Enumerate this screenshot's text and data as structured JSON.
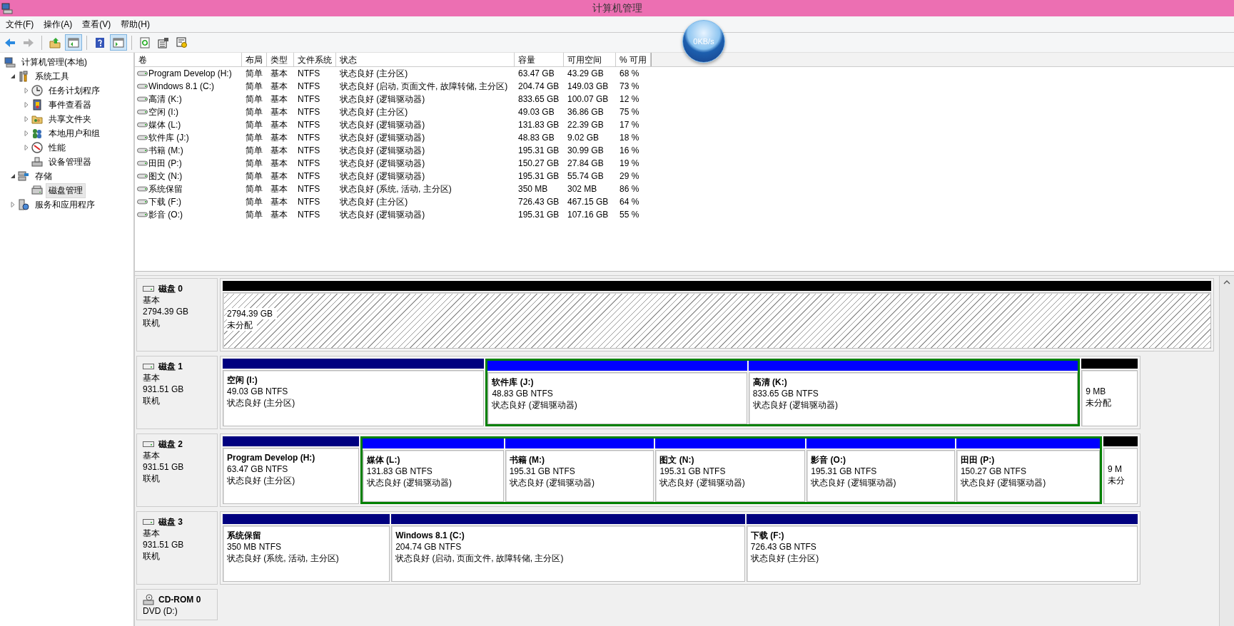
{
  "window": {
    "title": "计算机管理"
  },
  "menu": [
    "文件(F)",
    "操作(A)",
    "查看(V)",
    "帮助(H)"
  ],
  "toolbar": [
    {
      "kind": "back",
      "disabled": false,
      "pressed": false
    },
    {
      "kind": "forward",
      "disabled": true,
      "pressed": false
    },
    {
      "kind": "separator"
    },
    {
      "kind": "up",
      "disabled": false,
      "pressed": false
    },
    {
      "kind": "console-tree",
      "disabled": false,
      "pressed": true
    },
    {
      "kind": "separator"
    },
    {
      "kind": "help",
      "disabled": false,
      "pressed": false
    },
    {
      "kind": "action-pane",
      "disabled": false,
      "pressed": true
    },
    {
      "kind": "separator"
    },
    {
      "kind": "refresh",
      "disabled": false,
      "pressed": false
    },
    {
      "kind": "properties",
      "disabled": false,
      "pressed": false
    },
    {
      "kind": "settings",
      "disabled": false,
      "pressed": false
    }
  ],
  "network_speed": "0KB/s",
  "tree": [
    {
      "label": "计算机管理(本地)",
      "kind": "computer",
      "selected": false,
      "children": [
        {
          "label": "系统工具",
          "kind": "tools",
          "expanded": true,
          "selected": false,
          "children": [
            {
              "label": "任务计划程序",
              "kind": "clock",
              "expanded": false,
              "selected": false
            },
            {
              "label": "事件查看器",
              "kind": "event-log",
              "expanded": false,
              "selected": false
            },
            {
              "label": "共享文件夹",
              "kind": "shared-folder",
              "expanded": false,
              "selected": false
            },
            {
              "label": "本地用户和组",
              "kind": "users",
              "expanded": false,
              "selected": false
            },
            {
              "label": "性能",
              "kind": "performance",
              "expanded": false,
              "selected": false
            },
            {
              "label": "设备管理器",
              "kind": "device",
              "selected": false
            }
          ]
        },
        {
          "label": "存储",
          "kind": "storage",
          "expanded": true,
          "selected": false,
          "children": [
            {
              "label": "磁盘管理",
              "kind": "disk",
              "selected": true
            }
          ]
        },
        {
          "label": "服务和应用程序",
          "kind": "services",
          "expanded": false,
          "selected": false
        }
      ]
    }
  ],
  "table": {
    "columns": [
      "卷",
      "布局",
      "类型",
      "文件系统",
      "状态",
      "容量",
      "可用空间",
      "% 可用"
    ],
    "rows": [
      [
        "Program Develop (H:)",
        "简单",
        "基本",
        "NTFS",
        "状态良好 (主分区)",
        "63.47 GB",
        "43.29 GB",
        "68 %"
      ],
      [
        "Windows 8.1 (C:)",
        "简单",
        "基本",
        "NTFS",
        "状态良好 (启动, 页面文件, 故障转储, 主分区)",
        "204.74 GB",
        "149.03 GB",
        "73 %"
      ],
      [
        "高清 (K:)",
        "简单",
        "基本",
        "NTFS",
        "状态良好 (逻辑驱动器)",
        "833.65 GB",
        "100.07 GB",
        "12 %"
      ],
      [
        "空闲 (I:)",
        "简单",
        "基本",
        "NTFS",
        "状态良好 (主分区)",
        "49.03 GB",
        "36.86 GB",
        "75 %"
      ],
      [
        "媒体 (L:)",
        "简单",
        "基本",
        "NTFS",
        "状态良好 (逻辑驱动器)",
        "131.83 GB",
        "22.39 GB",
        "17 %"
      ],
      [
        "软件库 (J:)",
        "简单",
        "基本",
        "NTFS",
        "状态良好 (逻辑驱动器)",
        "48.83 GB",
        "9.02 GB",
        "18 %"
      ],
      [
        "书籍 (M:)",
        "简单",
        "基本",
        "NTFS",
        "状态良好 (逻辑驱动器)",
        "195.31 GB",
        "30.99 GB",
        "16 %"
      ],
      [
        "田田 (P:)",
        "简单",
        "基本",
        "NTFS",
        "状态良好 (逻辑驱动器)",
        "150.27 GB",
        "27.84 GB",
        "19 %"
      ],
      [
        "图文 (N:)",
        "简单",
        "基本",
        "NTFS",
        "状态良好 (逻辑驱动器)",
        "195.31 GB",
        "55.74 GB",
        "29 %"
      ],
      [
        "系统保留",
        "简单",
        "基本",
        "NTFS",
        "状态良好 (系统, 活动, 主分区)",
        "350 MB",
        "302 MB",
        "86 %"
      ],
      [
        "下载 (F:)",
        "简单",
        "基本",
        "NTFS",
        "状态良好 (主分区)",
        "726.43 GB",
        "467.15 GB",
        "64 %"
      ],
      [
        "影音 (O:)",
        "简单",
        "基本",
        "NTFS",
        "状态良好 (逻辑驱动器)",
        "195.31 GB",
        "107.16 GB",
        "55 %"
      ]
    ]
  },
  "disks": [
    {
      "kind": "disk",
      "name": "磁盘 0",
      "type": "基本",
      "size": "2794.39 GB",
      "status": "联机",
      "partitions": [
        {
          "kind": "unallocated",
          "size": "2794.39 GB",
          "status": "未分配",
          "selected": true
        }
      ]
    },
    {
      "kind": "disk",
      "name": "磁盘 1",
      "type": "基本",
      "size": "931.51 GB",
      "status": "联机",
      "partitions": [
        {
          "kind": "primary",
          "name": "空闲 (I:)",
          "size": "49.03 GB NTFS",
          "status": "状态良好 (主分区)",
          "selected": false
        },
        {
          "kind": "extended",
          "logical_drives": [
            {
              "kind": "logical",
              "name": "软件库 (J:)",
              "size": "48.83 GB NTFS",
              "status": "状态良好 (逻辑驱动器)",
              "selected": false
            },
            {
              "kind": "logical",
              "name": "高清 (K:)",
              "size": "833.65 GB NTFS",
              "status": "状态良好 (逻辑驱动器)",
              "selected": false
            }
          ]
        },
        {
          "kind": "unallocated",
          "size": "9 MB",
          "status": "未分配",
          "selected": false
        }
      ]
    },
    {
      "kind": "disk",
      "name": "磁盘 2",
      "type": "基本",
      "size": "931.51 GB",
      "status": "联机",
      "partitions": [
        {
          "kind": "primary",
          "name": "Program Develop (H:)",
          "size": "63.47 GB NTFS",
          "status": "状态良好 (主分区)",
          "selected": false
        },
        {
          "kind": "extended",
          "logical_drives": [
            {
              "kind": "logical",
              "name": "媒体 (L:)",
              "size": "131.83 GB NTFS",
              "status": "状态良好 (逻辑驱动器)",
              "selected": false
            },
            {
              "kind": "logical",
              "name": "书籍 (M:)",
              "size": "195.31 GB NTFS",
              "status": "状态良好 (逻辑驱动器)",
              "selected": false
            },
            {
              "kind": "logical",
              "name": "图文 (N:)",
              "size": "195.31 GB NTFS",
              "status": "状态良好 (逻辑驱动器)",
              "selected": false
            },
            {
              "kind": "logical",
              "name": "影音 (O:)",
              "size": "195.31 GB NTFS",
              "status": "状态良好 (逻辑驱动器)",
              "selected": false
            },
            {
              "kind": "logical",
              "name": "田田 (P:)",
              "size": "150.27 GB NTFS",
              "status": "状态良好 (逻辑驱动器)",
              "selected": false
            }
          ]
        },
        {
          "kind": "unallocated",
          "size": "9 M",
          "status": "未分",
          "selected": false
        }
      ]
    },
    {
      "kind": "disk",
      "name": "磁盘 3",
      "type": "基本",
      "size": "931.51 GB",
      "status": "联机",
      "partitions": [
        {
          "kind": "primary",
          "name": "系统保留",
          "size": "350 MB NTFS",
          "status": "状态良好 (系统, 活动, 主分区)",
          "selected": false
        },
        {
          "kind": "primary",
          "name": "Windows 8.1 (C:)",
          "size": "204.74 GB NTFS",
          "status": "状态良好 (启动, 页面文件, 故障转储, 主分区)",
          "selected": false
        },
        {
          "kind": "primary",
          "name": "下载 (F:)",
          "size": "726.43 GB NTFS",
          "status": "状态良好 (主分区)",
          "selected": false
        }
      ]
    },
    {
      "kind": "cdrom",
      "name": "CD-ROM 0",
      "type": "DVD (D:)"
    }
  ]
}
